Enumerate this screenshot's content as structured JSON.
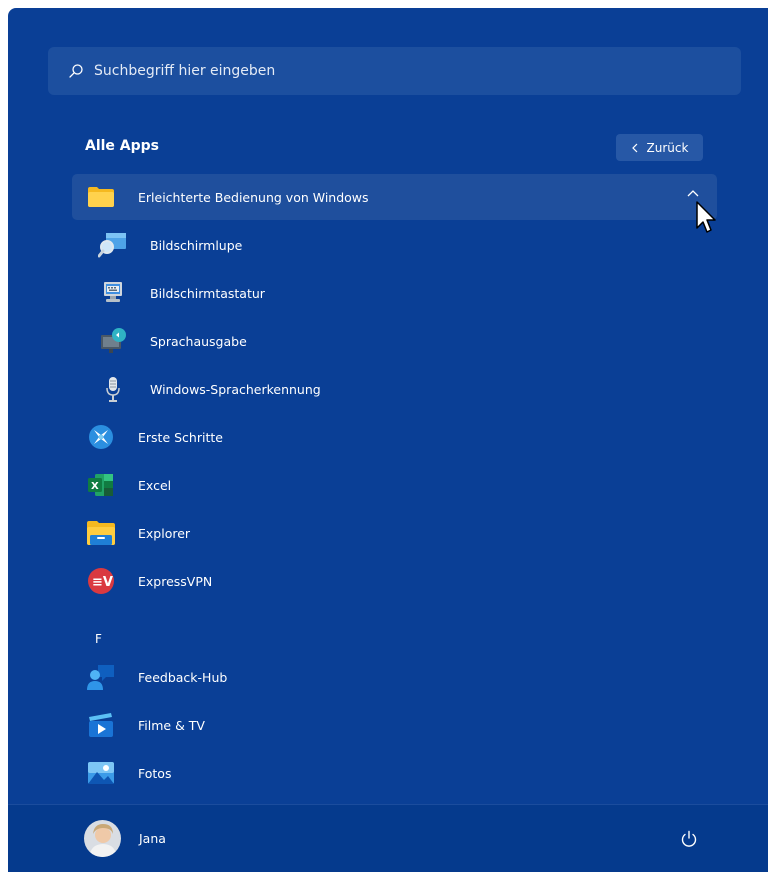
{
  "search": {
    "placeholder": "Suchbegriff hier eingeben"
  },
  "section": {
    "title": "Alle Apps",
    "back_label": "Zurück"
  },
  "apps": [
    {
      "label": "Erleichterte Bedienung von Windows",
      "icon": "folder-icon"
    },
    {
      "label": "Bildschirmlupe",
      "icon": "magnifier-icon"
    },
    {
      "label": "Bildschirmtastatur",
      "icon": "on-screen-keyboard-icon"
    },
    {
      "label": "Sprachausgabe",
      "icon": "narrator-icon"
    },
    {
      "label": "Windows-Spracherkennung",
      "icon": "microphone-icon"
    },
    {
      "label": "Erste Schritte",
      "icon": "get-started-icon"
    },
    {
      "label": "Excel",
      "icon": "excel-icon"
    },
    {
      "label": "Explorer",
      "icon": "file-explorer-icon"
    },
    {
      "label": "ExpressVPN",
      "icon": "expressvpn-icon"
    },
    {
      "label": "Feedback-Hub",
      "icon": "feedback-hub-icon"
    },
    {
      "label": "Filme & TV",
      "icon": "movies-tv-icon"
    },
    {
      "label": "Fotos",
      "icon": "photos-icon"
    }
  ],
  "letter_header": "F",
  "user": {
    "name": "Jana"
  },
  "colors": {
    "background": "#0a3f96",
    "selected_row": "#1f4f9d",
    "bottom_bar": "#053a8d"
  }
}
